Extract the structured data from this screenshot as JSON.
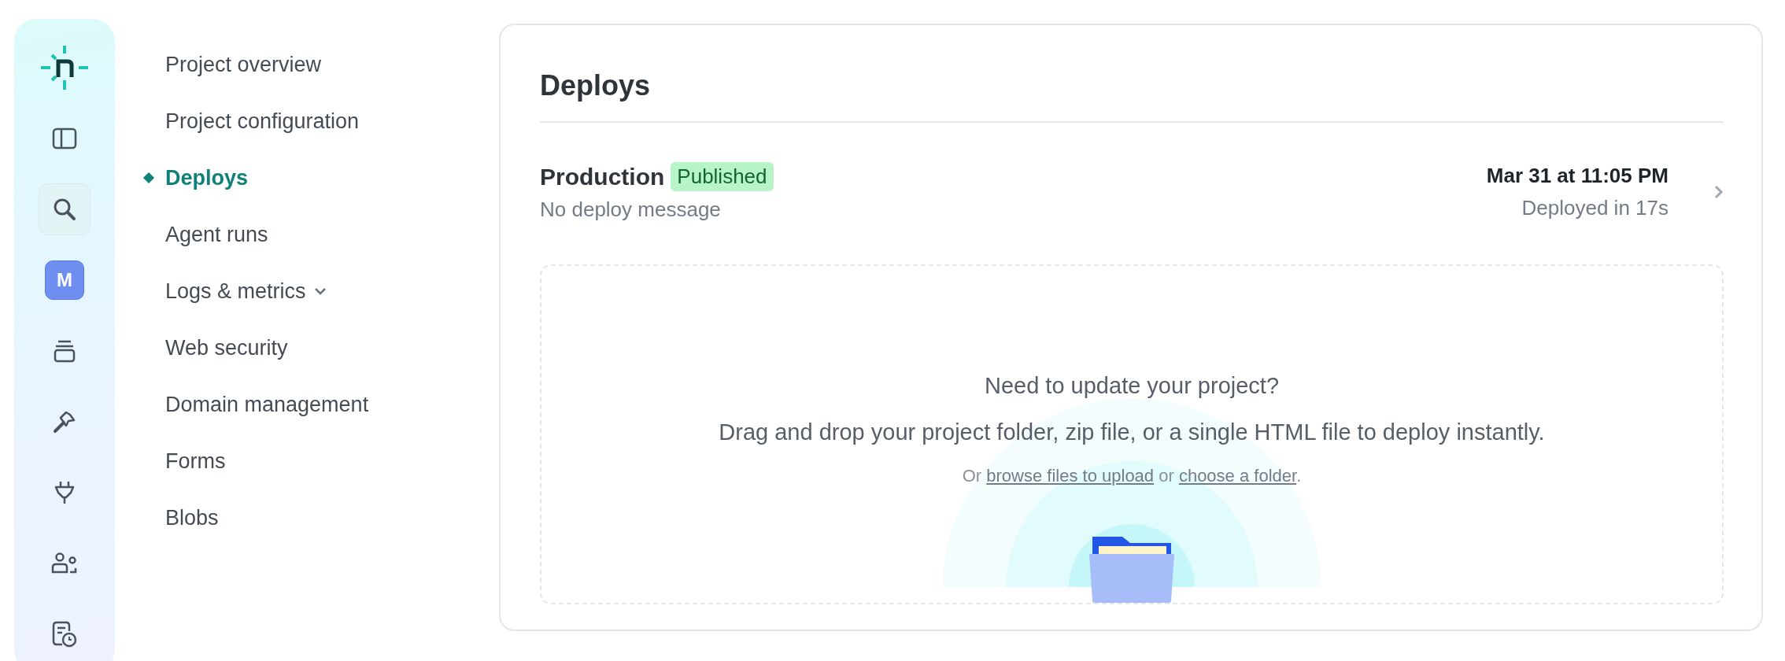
{
  "rail": {
    "items": [
      {
        "kind": "logo",
        "selected": false
      },
      {
        "kind": "panel",
        "selected": false
      },
      {
        "kind": "search",
        "selected": true
      },
      {
        "kind": "avatar",
        "label": "M",
        "selected": false
      },
      {
        "kind": "stack",
        "selected": false
      },
      {
        "kind": "hammer",
        "selected": false
      },
      {
        "kind": "plug",
        "selected": false
      },
      {
        "kind": "people",
        "selected": false
      },
      {
        "kind": "report",
        "selected": false
      }
    ]
  },
  "nav": {
    "items": [
      {
        "label": "Project overview",
        "selected": false,
        "expandable": false
      },
      {
        "label": "Project configuration",
        "selected": false,
        "expandable": false
      },
      {
        "label": "Deploys",
        "selected": true,
        "expandable": false
      },
      {
        "label": "Agent runs",
        "selected": false,
        "expandable": false
      },
      {
        "label": "Logs & metrics",
        "selected": false,
        "expandable": true
      },
      {
        "label": "Web security",
        "selected": false,
        "expandable": false
      },
      {
        "label": "Domain management",
        "selected": false,
        "expandable": false
      },
      {
        "label": "Forms",
        "selected": false,
        "expandable": false
      },
      {
        "label": "Blobs",
        "selected": false,
        "expandable": false
      }
    ]
  },
  "deploys": {
    "title": "Deploys",
    "production": {
      "name": "Production",
      "badge": "Published",
      "message": "No deploy message",
      "time": "Mar 31 at 11:05 PM",
      "duration": "Deployed in 17s"
    },
    "dropzone": {
      "heading": "Need to update your project?",
      "description": "Drag and drop your project folder, zip file, or a single HTML file to deploy instantly.",
      "links": [
        {
          "kind": "text",
          "text": "Or "
        },
        {
          "kind": "link",
          "text": "browse files to upload"
        },
        {
          "kind": "text",
          "text": " or "
        },
        {
          "kind": "link",
          "text": "choose a folder"
        },
        {
          "kind": "text",
          "text": "."
        }
      ]
    }
  }
}
